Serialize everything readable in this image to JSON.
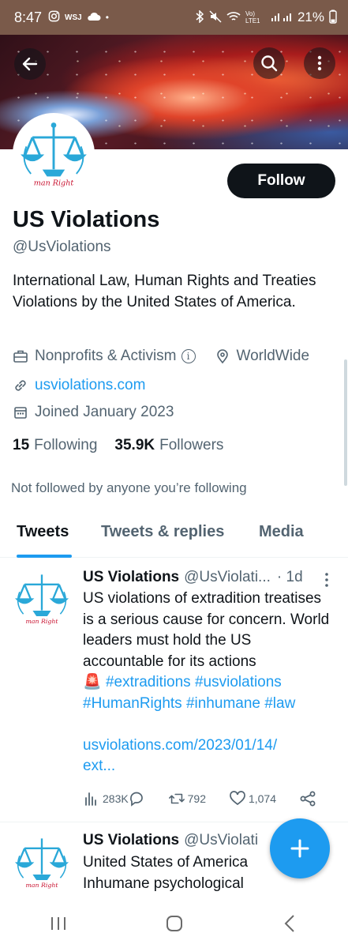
{
  "status_bar": {
    "time": "8:47",
    "left_icons": [
      "instagram-icon",
      "wsj-icon",
      "cloud-icon",
      "dot-icon"
    ],
    "network": "Vo) LTE1",
    "battery": "21%"
  },
  "profile": {
    "name": "US Violations",
    "handle": "@UsViolations",
    "follow_label": "Follow",
    "bio": "International Law, Human Rights and Treaties Violations by the United States of America.",
    "category": "Nonprofits & Activism",
    "location": "WorldWide",
    "website": "usviolations.com",
    "joined": "Joined January 2023",
    "following_count": "15",
    "following_label": "Following",
    "followers_count": "35.9K",
    "followers_label": "Followers",
    "not_followed": "Not followed by anyone you’re following"
  },
  "tabs": [
    {
      "label": "Tweets",
      "active": true
    },
    {
      "label": "Tweets & replies",
      "active": false
    },
    {
      "label": "Media",
      "active": false
    }
  ],
  "tweets": [
    {
      "name": "US Violations",
      "handle": "@UsViolati...",
      "time": "· 1d",
      "text_plain": "US violations of extradition treatises is a serious cause for concern. World leaders must hold the US accountable for its actions",
      "emoji": "🚨",
      "hashtags_line1": "#extraditions #usviolations",
      "hashtags_line2": "#HumanRights #inhumane #law",
      "link_line1": "usviolations.com/2023/01/14/",
      "link_line2": "ext...",
      "views": "283K",
      "replies": "",
      "retweets": "792",
      "likes": "1,074"
    },
    {
      "name": "US Violations",
      "handle": "@UsViolati",
      "text_line1": "United States of America",
      "text_line2": "Inhumane psychological"
    }
  ],
  "colors": {
    "accent": "#1d9bf0",
    "text": "#0f1419",
    "secondary": "#536471",
    "status_bar": "#7a5a4a"
  },
  "avatar_caption": "man Right"
}
